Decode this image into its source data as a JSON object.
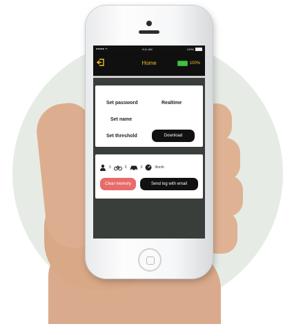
{
  "status_bar": {
    "carrier": "●●●●● ᯤ",
    "time": "9:41 AM",
    "battery": "100%"
  },
  "nav": {
    "title": "Home",
    "battery": "100%"
  },
  "settings": {
    "set_password": "Set password",
    "realtime": "Realtime",
    "set_name": "Set name",
    "set_threshold": "Set threshold",
    "download": "Download"
  },
  "stats": {
    "person_count": "0",
    "bike_count": "0",
    "car_count": "0",
    "speed": "0km/h"
  },
  "actions": {
    "clear_memory": "Clear memory",
    "send_log": "Send log with email"
  },
  "colors": {
    "accent": "#f0c020",
    "battery": "#3ec23e",
    "danger": "#e86b6b"
  },
  "icons": [
    "back-arrow-icon",
    "battery-icon",
    "person-icon",
    "bicycle-icon",
    "car-icon",
    "speedometer-icon"
  ]
}
